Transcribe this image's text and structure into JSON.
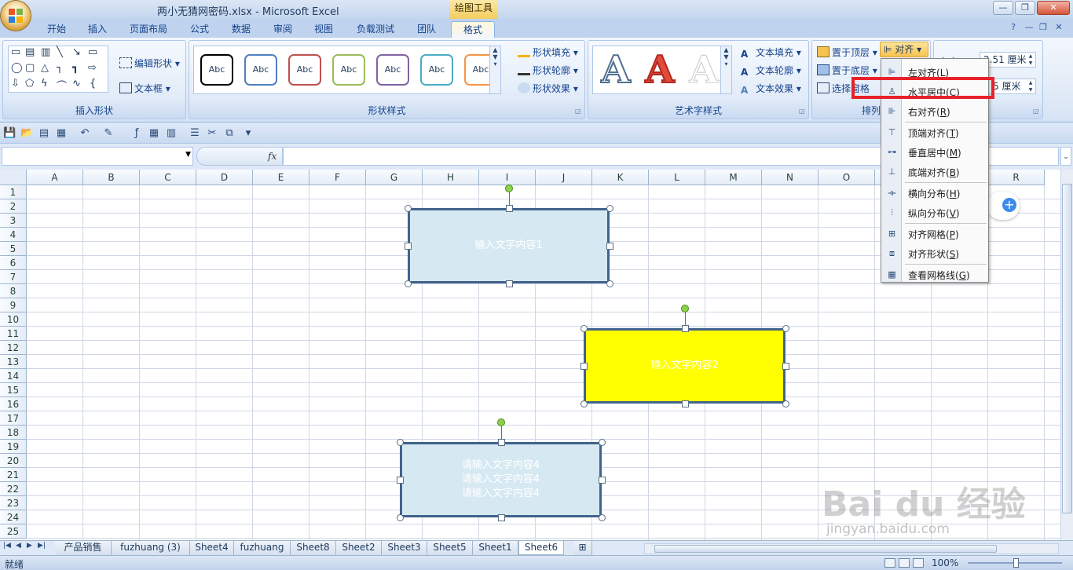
{
  "window": {
    "title": "两小无猜网密码.xlsx - Microsoft Excel",
    "context_tab_group": "绘图工具",
    "controls": [
      "—",
      "❐",
      "✕"
    ]
  },
  "tabs": [
    "开始",
    "插入",
    "页面布局",
    "公式",
    "数据",
    "审阅",
    "视图",
    "负载测试",
    "团队",
    "格式"
  ],
  "active_tab": "格式",
  "ribbon": {
    "insert_shapes": {
      "label": "插入形状",
      "edit_shape": "编辑形状",
      "text_box": "文本框"
    },
    "shape_styles": {
      "label": "形状样式",
      "gallery_text": "Abc",
      "gallery_colors": [
        "#000000",
        "#4f81bd",
        "#c0504d",
        "#9bbb59",
        "#8064a2",
        "#4bacc6",
        "#f79646"
      ],
      "fill": "形状填充",
      "outline": "形状轮廓",
      "effects": "形状效果"
    },
    "wordart_styles": {
      "label": "艺术字样式",
      "letter": "A",
      "fill": "文本填充",
      "outline": "文本轮廓",
      "effects": "文本效果"
    },
    "arrange": {
      "label": "排列",
      "bring_front": "置于顶层",
      "send_back": "置于底层",
      "selection_pane": "选择窗格",
      "align": "对齐"
    },
    "size": {
      "height_label": "高度:",
      "height_value": "2.51 厘米",
      "width_value": "6.75 厘米",
      "width_value_visible": "5 厘米"
    }
  },
  "formula_bar": {
    "fx": "fx",
    "value": ""
  },
  "columns": [
    "A",
    "B",
    "C",
    "D",
    "E",
    "F",
    "G",
    "H",
    "I",
    "J",
    "K",
    "L",
    "M",
    "N",
    "O",
    "P",
    "Q",
    "R"
  ],
  "rows": [
    "1",
    "2",
    "3",
    "4",
    "5",
    "6",
    "7",
    "8",
    "9",
    "10",
    "11",
    "12",
    "13",
    "14",
    "15",
    "16",
    "17",
    "18",
    "19",
    "20",
    "21",
    "22",
    "23",
    "24",
    "25"
  ],
  "shapes": [
    {
      "text": [
        "输入文字内容1"
      ],
      "fill": "#d6e9f2"
    },
    {
      "text": [
        "输入文字内容2"
      ],
      "fill": "#ffff00"
    },
    {
      "text": [
        "请输入文字内容4",
        "请输入文字内容4",
        "请输入文字内容4"
      ],
      "fill": "#d6e9f2"
    }
  ],
  "align_menu": {
    "items": [
      {
        "label": "左对齐(L)",
        "pre": "左对齐(",
        "key": "L",
        "icon": "align-left-icon"
      },
      {
        "label": "水平居中(C)",
        "pre": "水平居中(",
        "key": "C",
        "icon": "align-center-icon"
      },
      {
        "label": "右对齐(R)",
        "pre": "右对齐(",
        "key": "R",
        "icon": "align-right-icon"
      },
      {
        "label": "顶端对齐(T)",
        "pre": "顶端对齐(",
        "key": "T",
        "icon": "align-top-icon"
      },
      {
        "label": "垂直居中(M)",
        "pre": "垂直居中(",
        "key": "M",
        "icon": "align-middle-icon"
      },
      {
        "label": "底端对齐(B)",
        "pre": "底端对齐(",
        "key": "B",
        "icon": "align-bottom-icon"
      },
      {
        "label": "横向分布(H)",
        "pre": "横向分布(",
        "key": "H",
        "icon": "distribute-horizontal-icon"
      },
      {
        "label": "纵向分布(V)",
        "pre": "纵向分布(",
        "key": "V",
        "icon": "distribute-vertical-icon"
      },
      {
        "label": "对齐网格(P)",
        "pre": "对齐网格(",
        "key": "P",
        "icon": "snap-grid-icon"
      },
      {
        "label": "对齐形状(S)",
        "pre": "对齐形状(",
        "key": "S",
        "icon": "snap-shape-icon"
      },
      {
        "label": "查看网格线(G)",
        "pre": "查看网格线(",
        "key": "G",
        "icon": "view-gridlines-icon"
      }
    ],
    "highlighted": "水平居中(C)",
    "highlight_color": "#e8212a"
  },
  "sheets": [
    "产品销售",
    "fuzhuang (3)",
    "Sheet4",
    "fuzhuang",
    "Sheet8",
    "Sheet2",
    "Sheet3",
    "Sheet5",
    "Sheet1",
    "Sheet6"
  ],
  "active_sheet": "Sheet6",
  "status": {
    "ready": "就绪",
    "zoom": "100%"
  },
  "watermark": {
    "main": "Bai du 经验",
    "sub": "jingyan.baidu.com"
  }
}
